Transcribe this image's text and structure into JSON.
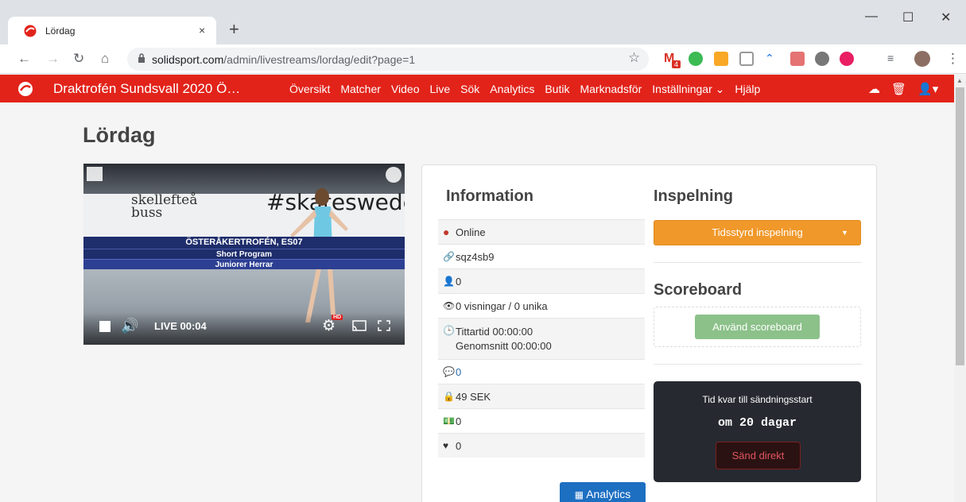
{
  "browser": {
    "tab_title": "Lördag",
    "tab_close": "×",
    "new_tab": "+",
    "url_host": "solidsport.com",
    "url_path": "/admin/livestreams/lordag/edit?page=1",
    "window_min": "—",
    "window_max": "☐",
    "window_close": "✕",
    "gmail_count": "4"
  },
  "appnav": {
    "brand": "Draktrofén Sundsvall 2020 Ö…",
    "menu": [
      "Översikt",
      "Matcher",
      "Video",
      "Live",
      "Sök",
      "Analytics",
      "Butik",
      "Marknadsför",
      "Inställningar ⌄",
      "Hjälp"
    ]
  },
  "page": {
    "title": "Lördag"
  },
  "video": {
    "ad_left": "skellefteå\nbuss",
    "ad_right": "#skatesweden",
    "caption_line1": "ÖSTERÅKERTROFÉN, ES07",
    "caption_line2": "Short Program",
    "caption_line3": "Juniorer Herrar",
    "live_label": "LIVE 00:04",
    "hd_badge": "HD"
  },
  "info": {
    "heading": "Information",
    "status": "Online",
    "code": "sqz4sb9",
    "users": "0",
    "views": "0 visningar / 0 unika",
    "watch_time": "Tittartid 00:00:00",
    "avg_time": "Genomsnitt  00:00:00",
    "comments": "0",
    "price": "49 SEK",
    "money": "0",
    "likes": "0",
    "analytics_button": "Analytics"
  },
  "recording": {
    "heading": "Inspelning",
    "button": "Tidsstyrd inspelning"
  },
  "scoreboard": {
    "heading": "Scoreboard",
    "button": "Använd scoreboard"
  },
  "countdown": {
    "label": "Tid kvar till sändningsstart",
    "value": "om 20 dagar",
    "button": "Sänd direkt"
  },
  "colors": {
    "brand_red": "#e2231a",
    "orange": "#f0982a",
    "green": "#8cc18a",
    "blue": "#1d6fc2",
    "online_dot": "#c0392b"
  }
}
